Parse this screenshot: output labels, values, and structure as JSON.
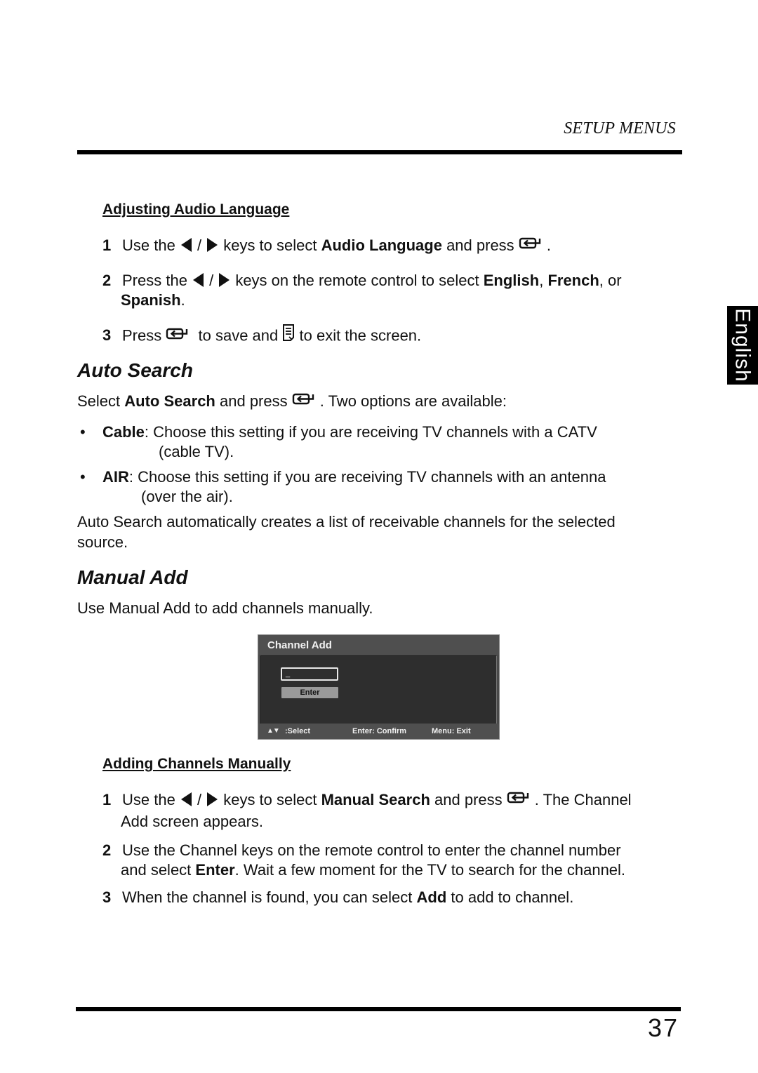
{
  "header": {
    "running_head": "SETUP MENUS"
  },
  "side_tab": {
    "language": "English"
  },
  "audio_language": {
    "subheading": "Adjusting Audio Language",
    "steps": [
      {
        "num": "1",
        "pre": "Use the",
        "mid": "keys to select",
        "bold": "Audio Language",
        "post": "and press",
        "end": "."
      },
      {
        "num": "2",
        "pre": "Press the",
        "mid": "keys on the remote control to select",
        "bold1": "English",
        "sep1": ",",
        "bold2": "French",
        "sep2": ", or",
        "bold3": "Spanish",
        "end": "."
      },
      {
        "num": "3",
        "pre": "Press",
        "mid": "to save and",
        "post": "to exit the screen."
      }
    ]
  },
  "auto_search": {
    "title": "Auto Search",
    "intro_pre": "Select",
    "intro_bold": "Auto Search",
    "intro_mid": "and press",
    "intro_post": ". Two options are available:",
    "options": [
      {
        "bullet": "•",
        "name": "Cable",
        "desc": ": Choose this setting if you are receiving TV channels with a CATV",
        "cont": "(cable TV)."
      },
      {
        "bullet": "•",
        "name": "AIR",
        "desc": ": Choose this setting if you are receiving TV channels with an antenna",
        "cont": "(over the air)."
      }
    ],
    "note_line1": "Auto Search automatically creates a list of receivable channels for the selected",
    "note_line2": "source."
  },
  "manual_add": {
    "title": "Manual Add",
    "intro": "Use Manual Add to add channels manually.",
    "osd": {
      "title": "Channel Add",
      "input_value": "_",
      "enter_button": "Enter",
      "footer": {
        "arrows": "▲▼",
        "select": ":Select",
        "confirm": "Enter: Confirm",
        "exit": "Menu: Exit"
      }
    },
    "subheading": "Adding Channels Manually",
    "steps": [
      {
        "num": "1",
        "pre": "Use the",
        "mid": "keys to select",
        "bold": "Manual Search",
        "post": "and press",
        "end": ". The Channel",
        "cont": "Add screen appears."
      },
      {
        "num": "2",
        "line1": "Use the Channel keys on the remote control to enter the channel number",
        "pre2": "and select",
        "bold2": "Enter",
        "post2": ". Wait a few moment for the TV to search for the channel."
      },
      {
        "num": "3",
        "pre": "When the channel is found, you can select",
        "bold": "Add",
        "post": "to add to channel."
      }
    ]
  },
  "footer": {
    "page_number": "37"
  }
}
